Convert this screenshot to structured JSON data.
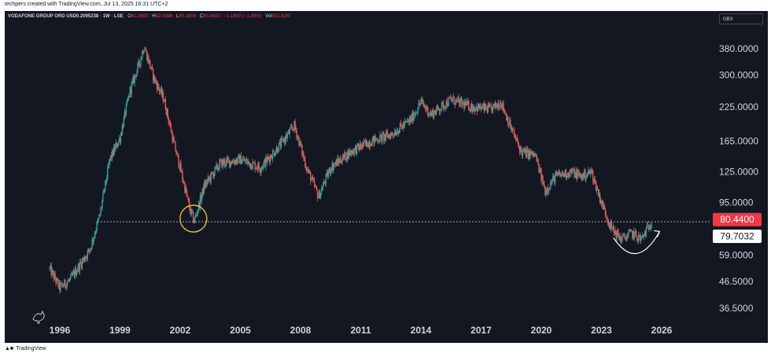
{
  "header": {
    "credit": "techpers created with TradingView.com, Jul 13, 2025 16:31 UTC+2"
  },
  "legend": {
    "symbol": "VODAFONE GROUP ORD USD0.2095238 · 1W · LSE",
    "open_label": "O",
    "open": "81.8600",
    "high_label": "H",
    "high": "82.4398",
    "low_label": "L",
    "low": "80.1800",
    "close_label": "C",
    "close": "80.4400",
    "change": "−1.1800 (−1.45%)",
    "vol_label": "Vol",
    "vol": "301.62M"
  },
  "currency": "GBX",
  "footer": {
    "brand": "TradingView",
    "logo_icon": "tradingview-logo-icon"
  },
  "colors": {
    "background": "#131722",
    "up": "#26a69a",
    "down": "#ef5350",
    "price_tag": "#f23645",
    "highlight_circle": "#e6c229",
    "arc": "#ffffff"
  },
  "chart_data": {
    "type": "candlestick",
    "scale": "log",
    "interval": "1W",
    "x_ticks": [
      "1996",
      "1999",
      "2002",
      "2005",
      "2008",
      "2011",
      "2014",
      "2017",
      "2020",
      "2023",
      "2026"
    ],
    "y_ticks": [
      "380.0000",
      "300.0000",
      "225.0000",
      "165.0000",
      "125.0000",
      "95.0000",
      "59.0000",
      "46.5000",
      "36.5000"
    ],
    "price_labels": [
      {
        "text": "80.4400",
        "value": 80.44,
        "style": "last-price"
      },
      {
        "text": "79.7032",
        "value": 79.7032,
        "style": "horizontal-line"
      }
    ],
    "horizontal_line": 79.7032,
    "approx_close_path": [
      {
        "date": "1995.5",
        "value": 52
      },
      {
        "date": "1996.0",
        "value": 44
      },
      {
        "date": "1996.5",
        "value": 47
      },
      {
        "date": "1997.0",
        "value": 54
      },
      {
        "date": "1997.5",
        "value": 62
      },
      {
        "date": "1998.0",
        "value": 85
      },
      {
        "date": "1998.5",
        "value": 140
      },
      {
        "date": "1999.0",
        "value": 170
      },
      {
        "date": "1999.5",
        "value": 260
      },
      {
        "date": "2000.0",
        "value": 340
      },
      {
        "date": "2000.2",
        "value": 390
      },
      {
        "date": "2000.7",
        "value": 290
      },
      {
        "date": "2001.2",
        "value": 240
      },
      {
        "date": "2001.7",
        "value": 160
      },
      {
        "date": "2002.0",
        "value": 130
      },
      {
        "date": "2002.5",
        "value": 88
      },
      {
        "date": "2002.7",
        "value": 80
      },
      {
        "date": "2003.2",
        "value": 110
      },
      {
        "date": "2004.0",
        "value": 135
      },
      {
        "date": "2005.0",
        "value": 140
      },
      {
        "date": "2006.0",
        "value": 130
      },
      {
        "date": "2007.0",
        "value": 160
      },
      {
        "date": "2007.7",
        "value": 190
      },
      {
        "date": "2008.3",
        "value": 130
      },
      {
        "date": "2008.9",
        "value": 100
      },
      {
        "date": "2009.5",
        "value": 130
      },
      {
        "date": "2010.5",
        "value": 150
      },
      {
        "date": "2011.5",
        "value": 165
      },
      {
        "date": "2012.5",
        "value": 175
      },
      {
        "date": "2013.5",
        "value": 200
      },
      {
        "date": "2014.0",
        "value": 235
      },
      {
        "date": "2014.5",
        "value": 210
      },
      {
        "date": "2015.5",
        "value": 240
      },
      {
        "date": "2016.5",
        "value": 225
      },
      {
        "date": "2017.5",
        "value": 220
      },
      {
        "date": "2018.0",
        "value": 235
      },
      {
        "date": "2018.5",
        "value": 185
      },
      {
        "date": "2019.0",
        "value": 150
      },
      {
        "date": "2019.7",
        "value": 145
      },
      {
        "date": "2020.2",
        "value": 105
      },
      {
        "date": "2020.7",
        "value": 120
      },
      {
        "date": "2021.5",
        "value": 125
      },
      {
        "date": "2022.0",
        "value": 120
      },
      {
        "date": "2022.5",
        "value": 125
      },
      {
        "date": "2023.0",
        "value": 95
      },
      {
        "date": "2023.5",
        "value": 75
      },
      {
        "date": "2024.0",
        "value": 68
      },
      {
        "date": "2024.5",
        "value": 72
      },
      {
        "date": "2025.0",
        "value": 68
      },
      {
        "date": "2025.5",
        "value": 80.44
      }
    ],
    "annotations": [
      {
        "type": "circle",
        "date": "2002.7",
        "value": 82,
        "color": "#e6c229"
      },
      {
        "type": "curved-arrow",
        "from_date": "2023.6",
        "to_date": "2025.9",
        "value": 68,
        "color": "#ffffff"
      }
    ]
  }
}
